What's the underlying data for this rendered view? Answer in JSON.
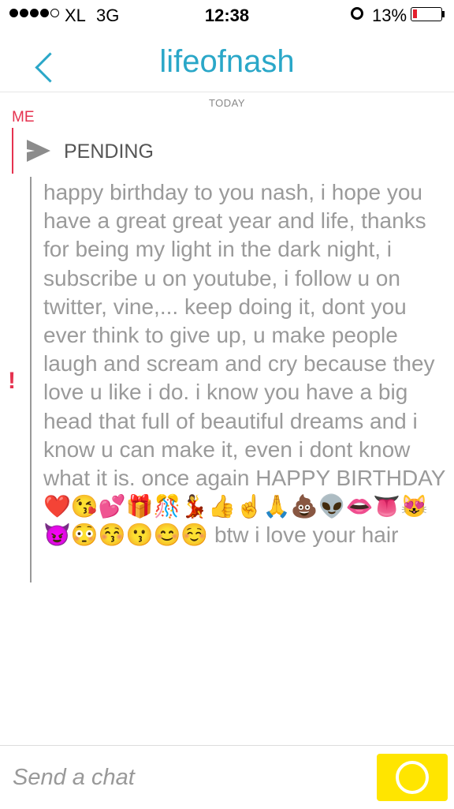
{
  "status_bar": {
    "carrier": "XL",
    "network": "3G",
    "time": "12:38",
    "battery": "13%",
    "battery_level": 0.13,
    "signal_bars": 4,
    "signal_max": 5
  },
  "header": {
    "back_icon": "chevron-left-icon",
    "title": "lifeofnash"
  },
  "conversation": {
    "date_label": "TODAY",
    "sender": "ME",
    "status": "PENDING",
    "message": "happy birthday to you nash, i hope you have a great great year and life, thanks for being my light in the dark night, i subscribe u on youtube, i follow u on twitter, vine,... keep doing it, dont you ever think to give up, u make people laugh and scream and cry because they love u like i do. i know you have a big head that full of beautiful dreams and i know u can make it, even i dont know what it is. once again HAPPY BIRTHDAY ❤️😘💕🎁🎊💃👍☝️🙏💩👽👄👅😻😈😳😚😗😊☺️ btw i love your hair",
    "error_marker": "!"
  },
  "composer": {
    "placeholder": "Send a chat",
    "camera_icon": "camera-shutter-icon"
  },
  "colors": {
    "accent": "#2aa7c8",
    "me": "#e5324f",
    "camera_button": "#ffe500"
  }
}
